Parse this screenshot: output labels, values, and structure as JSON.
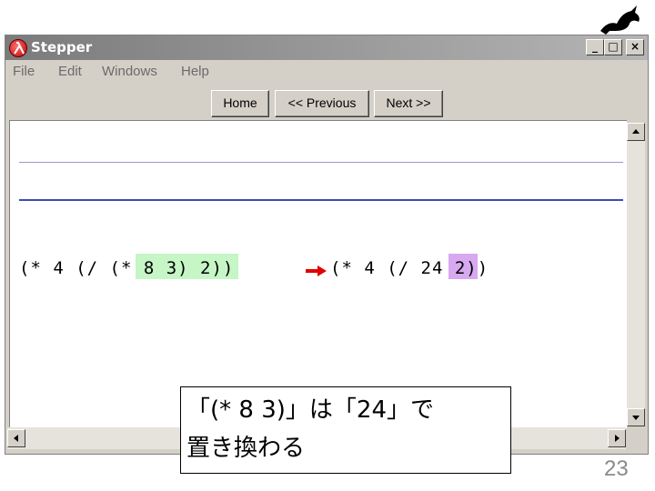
{
  "window": {
    "title": "Stepper"
  },
  "menu": [
    "File",
    "Edit",
    "Windows",
    "Help"
  ],
  "nav": {
    "home": "Home",
    "previous": "<< Previous",
    "next": "Next >>"
  },
  "step": {
    "before": "(* 4 (/ (* 8 3) 2))",
    "redex": "(* 8 3)",
    "after": "(* 4 (/ 24 2))",
    "result": "24",
    "before_highlight_color": "#c6f5c6",
    "after_highlight_color": "#d8a8f0",
    "arrow_color": "#e00000"
  },
  "caption": {
    "line1": "「(* 8 3)」は「24」で",
    "line2": "置き換わる"
  },
  "slide_number": "23"
}
